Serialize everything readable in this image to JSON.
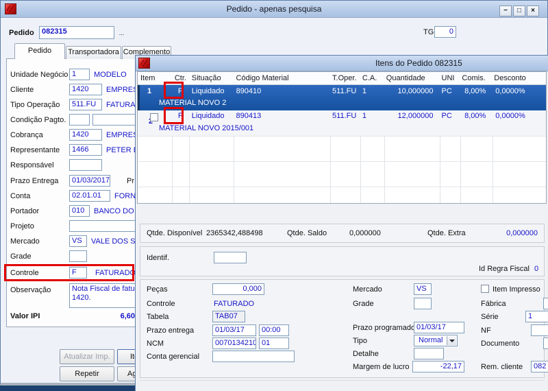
{
  "colors": {
    "annotation_red": "#e10000",
    "selected_row_blue": "#1d5cb4",
    "value_blue": "#1414c8",
    "titlebar_blue": "#b6cbe8"
  },
  "main_window": {
    "title": "Pedido - apenas pesquisa",
    "controls": {
      "minimize": "−",
      "maximize": "□",
      "close": "×"
    },
    "pedido": {
      "label": "Pedido",
      "value": "082315",
      "browse": "..."
    },
    "tg": {
      "label": "TG",
      "value": "0"
    },
    "tabs": [
      {
        "label": "Pedido"
      },
      {
        "label": "Transportadora"
      },
      {
        "label": "Complemento"
      }
    ],
    "fields": [
      {
        "label": "Unidade Negócio",
        "value": "1",
        "desc": "MODELO"
      },
      {
        "label": "Cliente",
        "value": "1420",
        "desc": "EMPRESA"
      },
      {
        "label": "Tipo Operação",
        "value": "511.FU",
        "desc": "FATURAM"
      },
      {
        "label": "Condição Pagto.",
        "value": "",
        "desc": ""
      },
      {
        "label": "Cobrança",
        "value": "1420",
        "desc": "EMPRESA"
      },
      {
        "label": "Representante",
        "value": "1466",
        "desc": "PETER BIS"
      },
      {
        "label": "Responsável",
        "value": "",
        "desc": ""
      },
      {
        "label": "Prazo Entrega",
        "value": "01/03/2017",
        "desc": "",
        "extra": "Pr"
      },
      {
        "label": "Conta",
        "value": "02.01.01",
        "desc": "FORNE"
      },
      {
        "label": "Portador",
        "value": "010",
        "desc": "BANCO DO BR"
      },
      {
        "label": "Projeto",
        "value": "",
        "desc": ""
      },
      {
        "label": "Mercado",
        "value": "VS",
        "desc": "VALE DOS SINO"
      },
      {
        "label": "Grade",
        "value": "",
        "desc": ""
      },
      {
        "label": "Controle",
        "value": "F",
        "desc": "FATURADO"
      }
    ],
    "observacao": {
      "label": "Observação",
      "line1": "Nota Fiscal de fatura",
      "line2": "1420."
    },
    "valor_ipi": {
      "label": "Valor IPI",
      "value": "6,60"
    },
    "buttons": {
      "atualizar_imp": "Atualizar Imp.",
      "itens_cut": "Ite",
      "repetir": "Repetir",
      "aglutinar_cut": "Agl"
    }
  },
  "items_window": {
    "title": "Itens do Pedido 082315",
    "table": {
      "columns": [
        "Item",
        "Ctr.",
        "Situação",
        "Código Material",
        "T.Oper.",
        "C.A.",
        "Quantidade",
        "UNI",
        "Comis.",
        "Desconto"
      ],
      "rows": [
        {
          "item": "1",
          "ctr": "F",
          "situacao": "Liquidado",
          "codigo_material": "890410",
          "t_oper": "511.FU",
          "ca": "1",
          "quantidade": "10,000000",
          "uni": "PC",
          "comis": "8,00%",
          "desconto": "0,0000%",
          "descricao": "MATERIAL NOVO 2",
          "selected": true
        },
        {
          "item": "2",
          "ctr": "F",
          "situacao": "Liquidado",
          "codigo_material": "890413",
          "t_oper": "511.FU",
          "ca": "1",
          "quantidade": "12,000000",
          "uni": "PC",
          "comis": "8,00%",
          "desconto": "0,0000%",
          "descricao": "MATERIAL NOVO 2015/001",
          "selected": false
        }
      ]
    },
    "totals": {
      "disponivel_label": "Qtde. Disponível",
      "disponivel_value": "2365342,488498",
      "saldo_label": "Qtde. Saldo",
      "saldo_value": "0,000000",
      "extra_label": "Qtde. Extra",
      "extra_value": "0,000000"
    },
    "identif": {
      "label": "Identif.",
      "value": "",
      "id_regra_label": "Id Regra Fiscal",
      "id_regra_value": "0"
    },
    "form": {
      "pecas": {
        "label": "Peças",
        "value": "0,000"
      },
      "controle": {
        "label": "Controle",
        "value": "FATURADO"
      },
      "tabela": {
        "label": "Tabela",
        "value": "TAB07"
      },
      "prazo_entrega": {
        "label": "Prazo entrega",
        "date": "01/03/17",
        "time": "00:00"
      },
      "ncm": {
        "label": "NCM",
        "value": "0070134210",
        "suffix": "01"
      },
      "conta_gerencial": {
        "label": "Conta gerencial",
        "value": ""
      },
      "mercado": {
        "label": "Mercado",
        "value": "VS"
      },
      "grade": {
        "label": "Grade",
        "value": ""
      },
      "prazo_programado": {
        "label": "Prazo programado",
        "value": "01/03/17"
      },
      "tipo": {
        "label": "Tipo",
        "value": "Normal"
      },
      "detalhe": {
        "label": "Detalhe",
        "value": ""
      },
      "margem_lucro": {
        "label": "Margem de lucro",
        "value": "-22,17"
      },
      "item_impresso": {
        "label": "Item Impresso",
        "checked": false
      },
      "fabrica": {
        "label": "Fábrica",
        "value": ""
      },
      "serie": {
        "label": "Série",
        "value": "1"
      },
      "nf": {
        "label": "NF",
        "value": ""
      },
      "documento": {
        "label": "Documento",
        "value": ""
      },
      "rem_cliente": {
        "label": "Rem. cliente",
        "value": "082"
      }
    }
  }
}
